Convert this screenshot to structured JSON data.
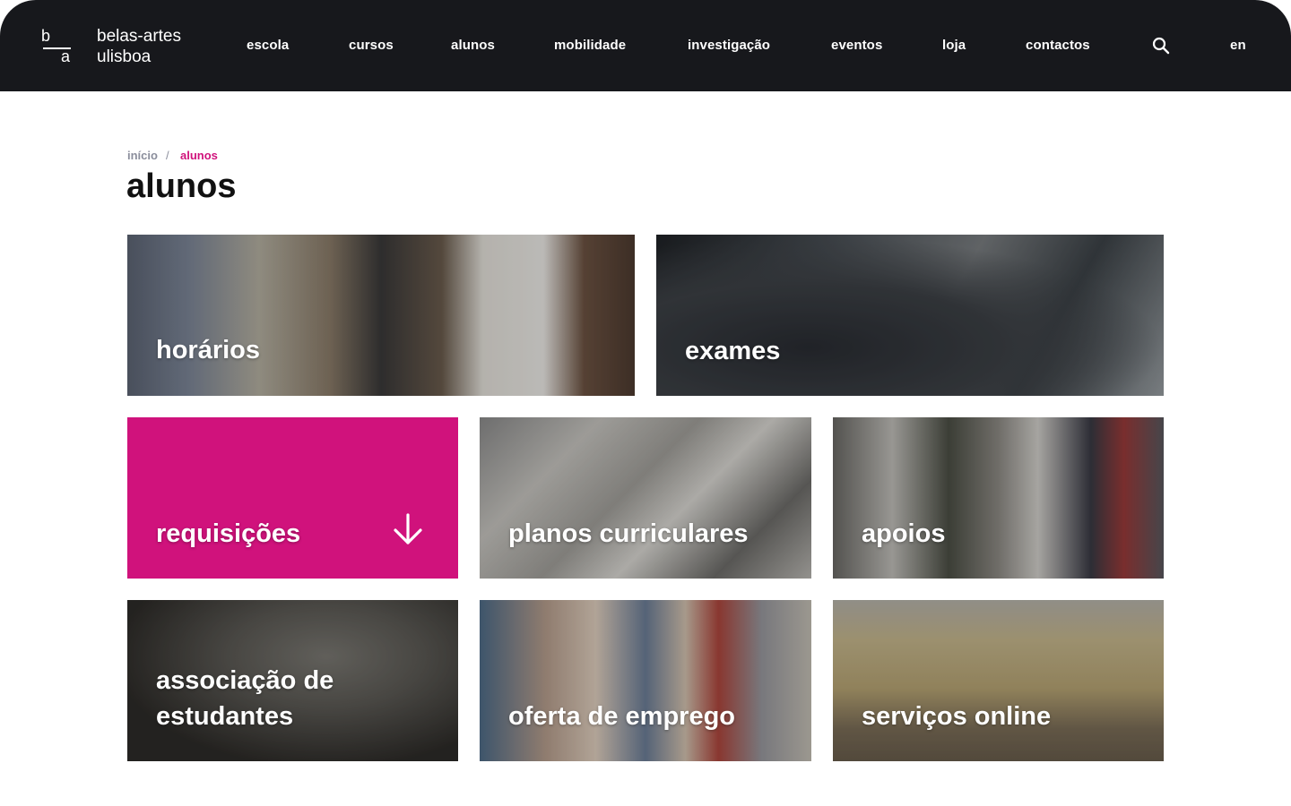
{
  "header": {
    "logo_top": "b",
    "logo_bottom": "a",
    "brand_line1": "belas-artes",
    "brand_line2": "ulisboa",
    "nav": [
      "escola",
      "cursos",
      "alunos",
      "mobilidade",
      "investigação",
      "eventos",
      "loja",
      "contactos"
    ],
    "search_icon": "search-icon",
    "language": "en"
  },
  "breadcrumb": {
    "home": "início",
    "separator": "/",
    "current": "alunos"
  },
  "page": {
    "title": "alunos"
  },
  "tiles": [
    {
      "label": "horários"
    },
    {
      "label": "exames"
    },
    {
      "label": "requisições",
      "icon": "arrow-down-icon"
    },
    {
      "label": "planos curriculares"
    },
    {
      "label": "apoios"
    },
    {
      "label": "associação de estudantes"
    },
    {
      "label": "oferta de emprego"
    },
    {
      "label": "serviços online"
    }
  ],
  "colors": {
    "header_bg": "#17181c",
    "accent": "#d0127c",
    "breadcrumb_muted": "#8b8e9c"
  }
}
